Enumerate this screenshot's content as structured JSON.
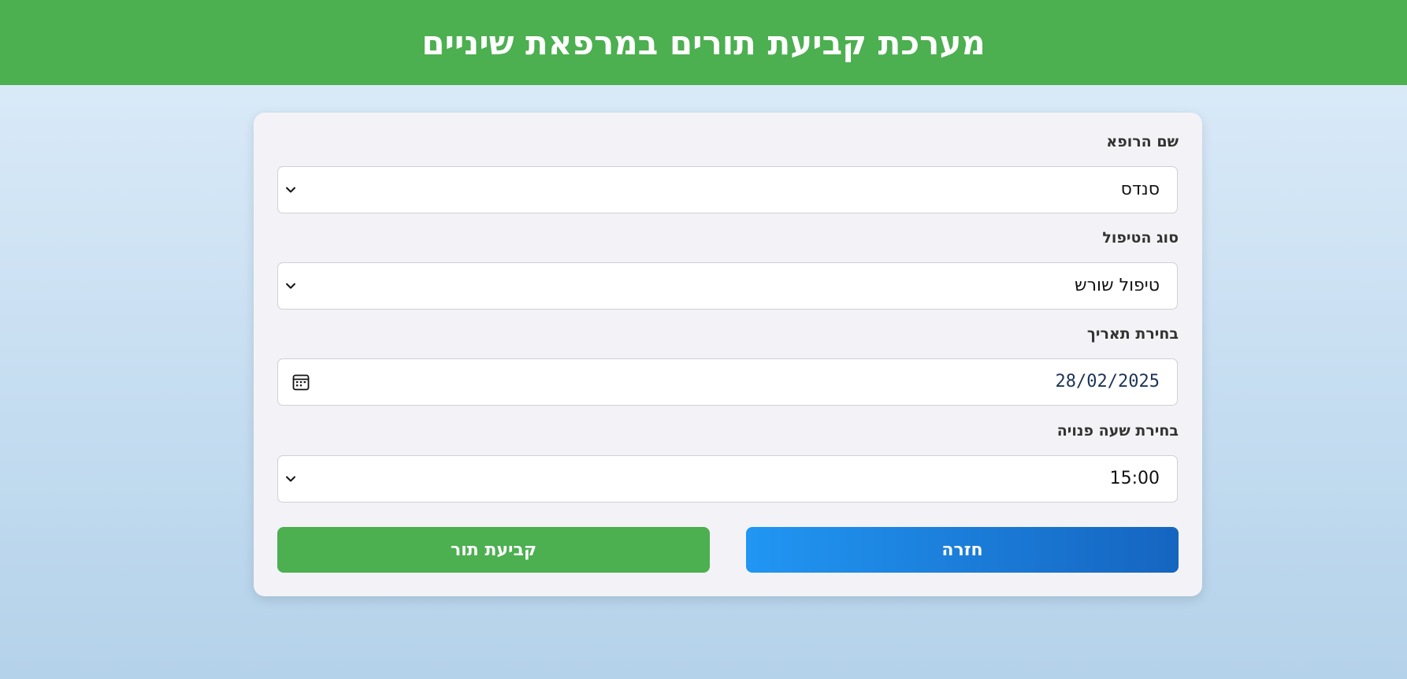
{
  "header": {
    "title": "מערכת קביעת תורים במרפאת שיניים"
  },
  "form": {
    "doctor": {
      "label": "שם הרופא",
      "value": "סנדס"
    },
    "treatment": {
      "label": "סוג הטיפול",
      "value": "טיפול שורש"
    },
    "date": {
      "label": "בחירת תאריך",
      "value": "28/02/2025"
    },
    "time": {
      "label": "בחירת שעה פנויה",
      "value": "15:00"
    }
  },
  "buttons": {
    "back_label": "חזרה",
    "book_label": "קביעת תור"
  },
  "colors": {
    "header_bg": "#4caf50",
    "book_button": "#4caf50",
    "back_button_start": "#2196f3",
    "back_button_end": "#1565c0"
  },
  "icons": {
    "select_arrow": "chevron-down-icon",
    "date_picker": "calendar-icon"
  }
}
